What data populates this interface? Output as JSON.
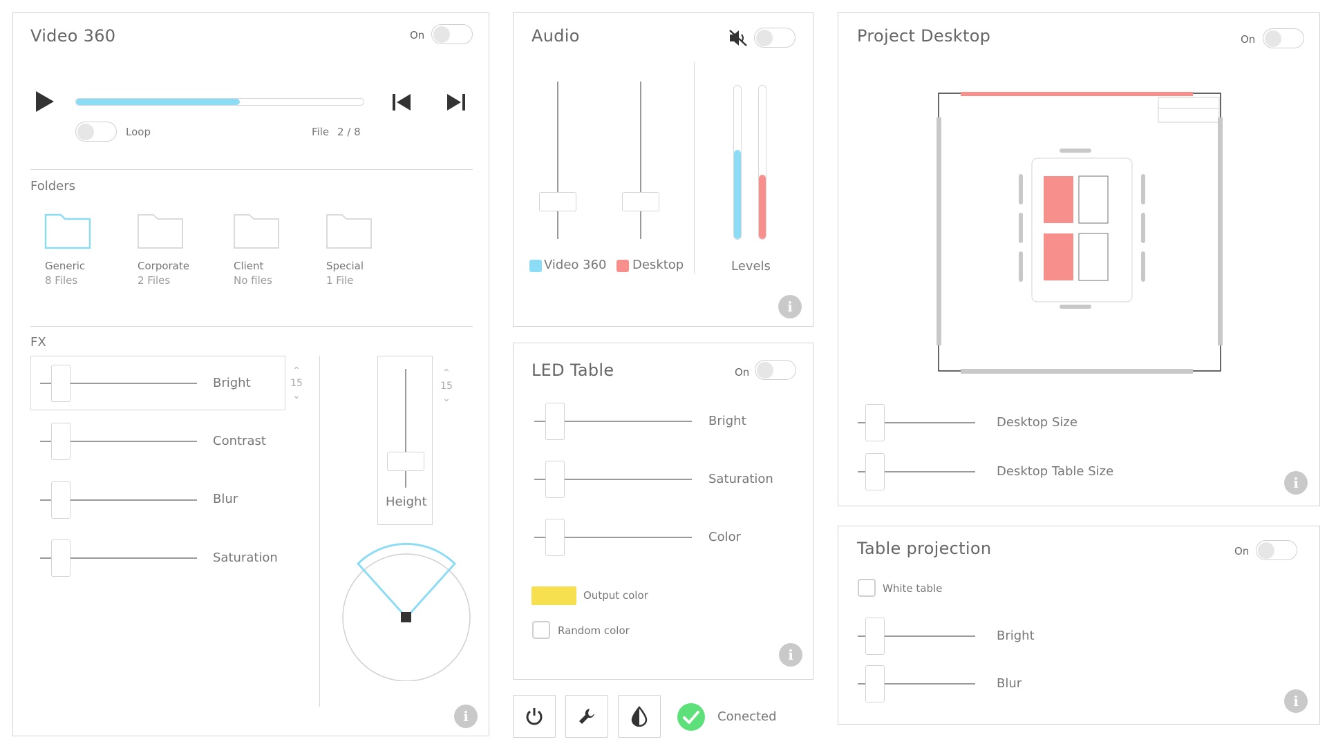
{
  "video360": {
    "title": "Video 360",
    "on_label": "On",
    "progress": 0.57,
    "loop_label": "Loop",
    "file_label": "File",
    "file_counter": "2 / 8",
    "folders_heading": "Folders",
    "folders": [
      {
        "name": "Generic",
        "count": "8 Files",
        "selected": true
      },
      {
        "name": "Corporate",
        "count": "2 Files",
        "selected": false
      },
      {
        "name": "Client",
        "count": "No files",
        "selected": false
      },
      {
        "name": "Special",
        "count": "1 File",
        "selected": false
      }
    ],
    "fx_heading": "FX",
    "fx_sliders": [
      {
        "label": "Bright",
        "value": 0.08
      },
      {
        "label": "Contrast",
        "value": 0.08
      },
      {
        "label": "Blur",
        "value": 0.08
      },
      {
        "label": "Saturation",
        "value": 0.08
      }
    ],
    "bright_spin_value": "15",
    "height_spin_value": "15",
    "height_label": "Height",
    "accent_color": "#8ddcf5"
  },
  "audio": {
    "title": "Audio",
    "channels": [
      {
        "label": "Video 360",
        "color": "#8ddcf5",
        "fader": 0.2
      },
      {
        "label": "Desktop",
        "color": "#f7908c",
        "fader": 0.2
      }
    ],
    "levels_label": "Levels",
    "levels": [
      0.58,
      0.42
    ]
  },
  "led_table": {
    "title": "LED Table",
    "on_label": "On",
    "sliders": [
      {
        "label": "Bright",
        "value": 0.08
      },
      {
        "label": "Saturation",
        "value": 0.08
      },
      {
        "label": "Color",
        "value": 0.08
      }
    ],
    "output_color_label": "Output color",
    "output_color": "#f7e050",
    "random_color_label": "Random color"
  },
  "project_desktop": {
    "title": "Project Desktop",
    "on_label": "On",
    "sliders": [
      {
        "label": "Desktop Size",
        "value": 0.08
      },
      {
        "label": "Desktop Table Size",
        "value": 0.08
      }
    ],
    "highlight_color": "#f7908c"
  },
  "table_projection": {
    "title": "Table projection",
    "on_label": "On",
    "white_table_label": "White table",
    "sliders": [
      {
        "label": "Bright",
        "value": 0.08
      },
      {
        "label": "Blur",
        "value": 0.08
      }
    ]
  },
  "bottom_bar": {
    "status_text": "Conected",
    "status_color": "#5de07a",
    "buttons": [
      {
        "icon": "power-icon"
      },
      {
        "icon": "wrench-icon"
      },
      {
        "icon": "contrast-drop-icon"
      }
    ]
  }
}
